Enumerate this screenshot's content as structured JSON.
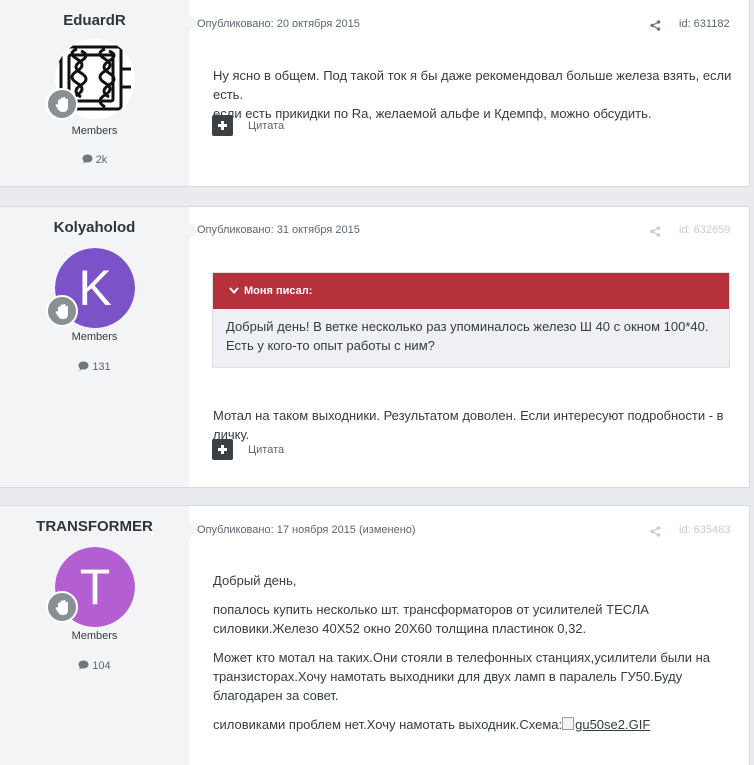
{
  "posts": [
    {
      "author": "EduardR",
      "group": "Members",
      "count": "2k",
      "date_label": "Опубликовано: 20 октября 2015",
      "post_id": "id: 631182",
      "lines": [
        "Ну ясно в общем. Под такой ток я бы даже рекомендовал больше железа взять, если есть.",
        "если есть прикидки по Ra, желаемой альфе и Кдемпф, можно обсудить."
      ],
      "quote_label": "Цитата"
    },
    {
      "author": "Kolyaholod",
      "avatar_letter": "K",
      "avatar_color": "#7b52c8",
      "group": "Members",
      "count": "131",
      "date_label": "Опубликовано: 31 октября 2015",
      "post_id": "id: 632659",
      "quote": {
        "header": "Моня писал:",
        "text": "Добрый день! В ветке несколько раз упоминалось железо Ш 40 с окном 100*40. Есть у кого-то опыт работы с ним?"
      },
      "text": "Мотал на таком выходники. Результатом доволен. Если интересуют подробности - в личку.",
      "quote_label": "Цитата"
    },
    {
      "author": "TRANSFORMER",
      "avatar_letter": "T",
      "avatar_color": "#b35ed1",
      "group": "Members",
      "count": "104",
      "date_label": "Опубликовано: 17 ноября 2015 (изменено)",
      "post_id": "id: 635483",
      "paragraphs": [
        "Добрый день,",
        "попалось купить несколько шт. трансформаторов от усилителей ТЕСЛА силовики.Железо 40Х52 окно 20Х60 толщина пластинок 0,32.",
        "Может кто мотал на таких.Они стояли в телефонных станциях,усилители были на транзисторах.Хочу намотать выходники для двух ламп в паралель ГУ50.Буду благодарен за совет."
      ],
      "last_text": "силовиками проблем нет.Хочу намотать выходник.Схема:",
      "image_name": "gu50se2.GIF"
    }
  ],
  "colors": {
    "quote_header": "#b6313c",
    "badge": "#8a8f96",
    "author_bg": "#f3f4f6"
  }
}
